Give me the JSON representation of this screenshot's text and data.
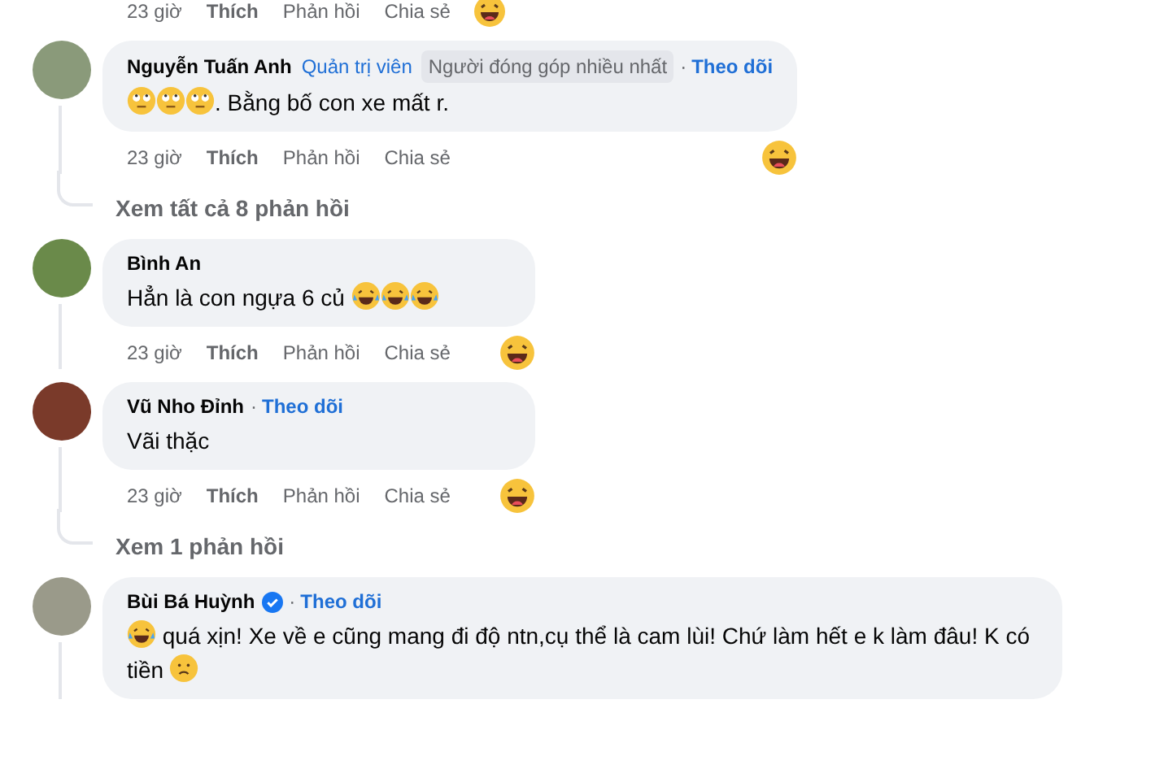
{
  "top_actions": {
    "time": "23 giờ",
    "like": "Thích",
    "reply": "Phản hồi",
    "share": "Chia sẻ"
  },
  "items": [
    {
      "kind": "comment",
      "name": "Nguyễn Tuấn Anh",
      "verified": false,
      "role": "Quản trị viên",
      "badge": "Người đóng góp nhiều nhất",
      "dot": "·",
      "follow": "Theo dõi",
      "body": [
        {
          "kind": "face-roll"
        },
        {
          "kind": "face-roll"
        },
        {
          "kind": "face-roll"
        },
        {
          "kind": "text",
          "text": ". Bằng bố con xe mất r."
        }
      ],
      "time": "23 giờ",
      "like": "Thích",
      "reply": "Phản hồi",
      "share": "Chia sẻ"
    },
    {
      "kind": "more",
      "text": "Xem tất cả 8 phản hồi"
    },
    {
      "kind": "comment",
      "name": "Bình An",
      "verified": false,
      "body": [
        {
          "kind": "text",
          "text": "Hẳn là con ngựa 6 củ "
        },
        {
          "kind": "face-tears"
        },
        {
          "kind": "face-tears"
        },
        {
          "kind": "face-tears"
        }
      ],
      "time": "23 giờ",
      "like": "Thích",
      "reply": "Phản hồi",
      "share": "Chia sẻ"
    },
    {
      "kind": "comment",
      "name": "Vũ Nho Đỉnh",
      "verified": false,
      "dot": "·",
      "follow": "Theo dõi",
      "body": [
        {
          "kind": "text",
          "text": "Vãi thặc"
        }
      ],
      "time": "23 giờ",
      "like": "Thích",
      "reply": "Phản hồi",
      "share": "Chia sẻ"
    },
    {
      "kind": "more",
      "text": "Xem 1 phản hồi"
    },
    {
      "kind": "comment",
      "name": "Bùi Bá Huỳnh",
      "verified": true,
      "dot": "·",
      "follow": "Theo dõi",
      "body": [
        {
          "kind": "face-tears"
        },
        {
          "kind": "text",
          "text": " quá xịn! Xe về e cũng mang đi độ ntn,cụ thể là cam lùi! Chứ làm hết e k làm đâu! K có tiền "
        },
        {
          "kind": "face-sad"
        }
      ]
    }
  ]
}
